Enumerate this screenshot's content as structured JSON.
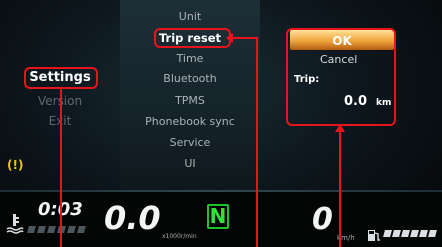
{
  "left_menu": {
    "items": [
      {
        "label": "Settings",
        "selected": true
      },
      {
        "label": "Version",
        "selected": false
      },
      {
        "label": "Exit",
        "selected": false
      }
    ]
  },
  "center_menu": {
    "items": [
      {
        "label": "Unit",
        "selected": false
      },
      {
        "label": "Trip reset",
        "selected": true
      },
      {
        "label": "Time",
        "selected": false
      },
      {
        "label": "Bluetooth",
        "selected": false
      },
      {
        "label": "TPMS",
        "selected": false
      },
      {
        "label": "Phonebook sync",
        "selected": false
      },
      {
        "label": "Service",
        "selected": false
      },
      {
        "label": "UI",
        "selected": false
      }
    ]
  },
  "right_panel": {
    "ok_label": "OK",
    "cancel_label": "Cancel",
    "trip_label": "Trip:",
    "trip_value": "0.0",
    "trip_unit": "km"
  },
  "status": {
    "clock": "0:03",
    "rpm_value": "0.0",
    "rpm_unit": "x1000r/min",
    "gear": "N",
    "speed_value": "0",
    "speed_unit": "km/h"
  },
  "icons": {
    "tire_pressure_warning": "tpms-warning-icon",
    "coolant": "coolant-temperature-icon",
    "fuel": "fuel-pump-icon"
  },
  "colors": {
    "highlight_border": "#e8141c",
    "ok_bar": "#f0a43a",
    "gear_green": "#20c22c",
    "warning_amber": "#f0c400"
  }
}
